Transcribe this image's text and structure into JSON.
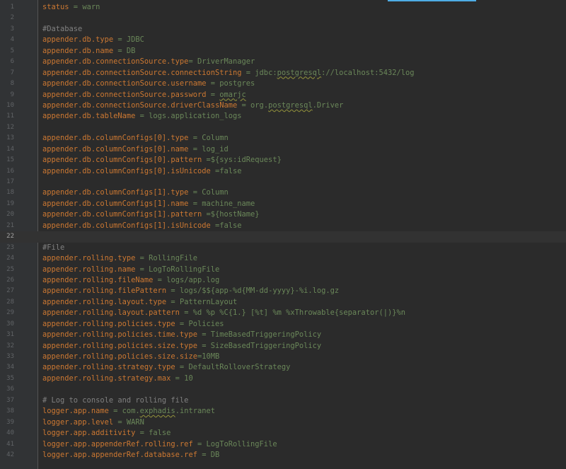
{
  "editor": {
    "accent_color": "#4eade5",
    "current_line": 22,
    "lines": [
      {
        "n": "1",
        "key": "status",
        "sep": " = ",
        "val": "warn"
      },
      {
        "n": "2"
      },
      {
        "n": "3",
        "comment": "#Database"
      },
      {
        "n": "4",
        "key": "appender.db.type",
        "sep": " = ",
        "val": "JDBC"
      },
      {
        "n": "5",
        "key": "appender.db.name",
        "sep": " = ",
        "val": "DB"
      },
      {
        "n": "6",
        "key": "appender.db.connectionSource.type",
        "sep": "= ",
        "val": "DriverManager"
      },
      {
        "n": "7",
        "key": "appender.db.connectionSource.connectionString",
        "sep": " = ",
        "val": "jdbc:postgresql://localhost:5432/log"
      },
      {
        "n": "8",
        "key": "appender.db.connectionSource.username",
        "sep": " = ",
        "val": "postgres"
      },
      {
        "n": "9",
        "key": "appender.db.connectionSource.password",
        "sep": " = ",
        "val": "omarjc"
      },
      {
        "n": "10",
        "key": "appender.db.connectionSource.driverClassName",
        "sep": " = ",
        "val": "org.postgresql.Driver"
      },
      {
        "n": "11",
        "key": "appender.db.tableName",
        "sep": " = ",
        "val": "logs.application_logs"
      },
      {
        "n": "12"
      },
      {
        "n": "13",
        "key": "appender.db.columnConfigs[0].type",
        "sep": " = ",
        "val": "Column"
      },
      {
        "n": "14",
        "key": "appender.db.columnConfigs[0].name",
        "sep": " = ",
        "val": "log_id"
      },
      {
        "n": "15",
        "key": "appender.db.columnConfigs[0].pattern",
        "sep": " =",
        "val": "${sys:idRequest}"
      },
      {
        "n": "16",
        "key": "appender.db.columnConfigs[0].isUnicode",
        "sep": " =",
        "val": "false"
      },
      {
        "n": "17"
      },
      {
        "n": "18",
        "key": "appender.db.columnConfigs[1].type",
        "sep": " = ",
        "val": "Column"
      },
      {
        "n": "19",
        "key": "appender.db.columnConfigs[1].name",
        "sep": " = ",
        "val": "machine_name"
      },
      {
        "n": "20",
        "key": "appender.db.columnConfigs[1].pattern",
        "sep": " =",
        "val": "${hostName}"
      },
      {
        "n": "21",
        "key": "appender.db.columnConfigs[1].isUnicode",
        "sep": " =",
        "val": "false"
      },
      {
        "n": "22"
      },
      {
        "n": "23",
        "comment": "#File"
      },
      {
        "n": "24",
        "key": "appender.rolling.type",
        "sep": " = ",
        "val": "RollingFile"
      },
      {
        "n": "25",
        "key": "appender.rolling.name",
        "sep": " = ",
        "val": "LogToRollingFile"
      },
      {
        "n": "26",
        "key": "appender.rolling.fileName",
        "sep": " = ",
        "val": "logs/app.log"
      },
      {
        "n": "27",
        "key": "appender.rolling.filePattern",
        "sep": " = ",
        "val": "logs/$${app-%d{MM-dd-yyyy}-%i.log.gz"
      },
      {
        "n": "28",
        "key": "appender.rolling.layout.type",
        "sep": " = ",
        "val": "PatternLayout"
      },
      {
        "n": "29",
        "key": "appender.rolling.layout.pattern",
        "sep": " = ",
        "val": "%d %p %C{1.} [%t] %m %xThrowable{separator(|)}%n"
      },
      {
        "n": "30",
        "key": "appender.rolling.policies.type",
        "sep": " = ",
        "val": "Policies"
      },
      {
        "n": "31",
        "key": "appender.rolling.policies.time.type",
        "sep": " = ",
        "val": "TimeBasedTriggeringPolicy"
      },
      {
        "n": "32",
        "key": "appender.rolling.policies.size.type",
        "sep": " = ",
        "val": "SizeBasedTriggeringPolicy"
      },
      {
        "n": "33",
        "key": "appender.rolling.policies.size.size",
        "sep": "=",
        "val": "10MB"
      },
      {
        "n": "34",
        "key": "appender.rolling.strategy.type",
        "sep": " = ",
        "val": "DefaultRolloverStrategy"
      },
      {
        "n": "35",
        "key": "appender.rolling.strategy.max",
        "sep": " = ",
        "val": "10"
      },
      {
        "n": "36"
      },
      {
        "n": "37",
        "comment": "# Log to console and rolling file"
      },
      {
        "n": "38",
        "key": "logger.app.name",
        "sep": " = ",
        "val": "com.exphadis.intranet"
      },
      {
        "n": "39",
        "key": "logger.app.level",
        "sep": " = ",
        "val": "WARN"
      },
      {
        "n": "40",
        "key": "logger.app.additivity",
        "sep": " = ",
        "val": "false"
      },
      {
        "n": "41",
        "key": "logger.app.appenderRef.rolling.ref",
        "sep": " = ",
        "val": "LogToRollingFile"
      },
      {
        "n": "42",
        "key": "logger.app.appenderRef.database.ref",
        "sep": " = ",
        "val": "DB"
      }
    ]
  }
}
